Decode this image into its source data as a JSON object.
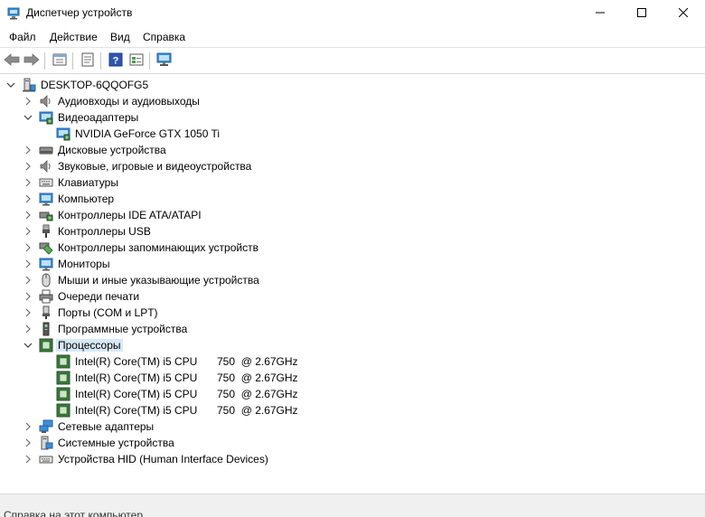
{
  "window": {
    "title": "Диспетчер устройств",
    "icon": "device-manager-icon",
    "controls": [
      "minimize-icon",
      "maximize-icon",
      "close-icon"
    ]
  },
  "menu": {
    "items": [
      {
        "label": "Файл"
      },
      {
        "label": "Действие"
      },
      {
        "label": "Вид"
      },
      {
        "label": "Справка"
      }
    ]
  },
  "toolbar": {
    "buttons": [
      "back-icon",
      "forward-icon",
      "properties-icon",
      "update-driver-icon",
      "help-icon",
      "view-icon",
      "scan-hardware-icon"
    ]
  },
  "tree": {
    "root": {
      "label": "DESKTOP-6QQOFG5",
      "icon": "computer-icon"
    },
    "categories": [
      {
        "label": "Аудиовходы и аудиовыходы",
        "icon": "speaker-icon",
        "expanded": false
      },
      {
        "label": "Видеоадаптеры",
        "icon": "display-adapter-icon",
        "expanded": true,
        "children": [
          {
            "label": "NVIDIA GeForce GTX 1050 Ti",
            "icon": "display-adapter-icon"
          }
        ]
      },
      {
        "label": "Дисковые устройства",
        "icon": "disk-drive-icon",
        "expanded": false
      },
      {
        "label": "Звуковые, игровые и видеоустройства",
        "icon": "speaker-icon",
        "expanded": false
      },
      {
        "label": "Клавиатуры",
        "icon": "keyboard-icon",
        "expanded": false
      },
      {
        "label": "Компьютер",
        "icon": "monitor-icon",
        "expanded": false
      },
      {
        "label": "Контроллеры IDE ATA/ATAPI",
        "icon": "ide-controller-icon",
        "expanded": false
      },
      {
        "label": "Контроллеры USB",
        "icon": "usb-icon",
        "expanded": false
      },
      {
        "label": "Контроллеры запоминающих устройств",
        "icon": "storage-controller-icon",
        "expanded": false
      },
      {
        "label": "Мониторы",
        "icon": "monitor-icon",
        "expanded": false
      },
      {
        "label": "Мыши и иные указывающие устройства",
        "icon": "mouse-icon",
        "expanded": false
      },
      {
        "label": "Очереди печати",
        "icon": "printer-icon",
        "expanded": false
      },
      {
        "label": "Порты (COM и LPT)",
        "icon": "port-icon",
        "expanded": false
      },
      {
        "label": "Программные устройства",
        "icon": "software-device-icon",
        "expanded": false
      },
      {
        "label": "Процессоры",
        "icon": "processor-icon",
        "expanded": true,
        "selected": true,
        "children": [
          {
            "name": "Intel(R) Core(TM) i5 CPU",
            "freq": "750  @ 2.67GHz",
            "icon": "processor-icon"
          },
          {
            "name": "Intel(R) Core(TM) i5 CPU",
            "freq": "750  @ 2.67GHz",
            "icon": "processor-icon"
          },
          {
            "name": "Intel(R) Core(TM) i5 CPU",
            "freq": "750  @ 2.67GHz",
            "icon": "processor-icon"
          },
          {
            "name": "Intel(R) Core(TM) i5 CPU",
            "freq": "750  @ 2.67GHz",
            "icon": "processor-icon"
          }
        ]
      },
      {
        "label": "Сетевые адаптеры",
        "icon": "network-adapter-icon",
        "expanded": false
      },
      {
        "label": "Системные устройства",
        "icon": "system-device-icon",
        "expanded": false
      },
      {
        "label": "Устройства HID (Human Interface Devices)",
        "icon": "hid-icon",
        "expanded": false
      }
    ]
  },
  "status": {
    "text": "Справка на этот компьютер"
  },
  "colors": {
    "selection": "#d7e8f7",
    "chevron": "#6e6e6e",
    "cpu_green": "#3c7a3c",
    "monitor_blue": "#3a8fd8"
  }
}
